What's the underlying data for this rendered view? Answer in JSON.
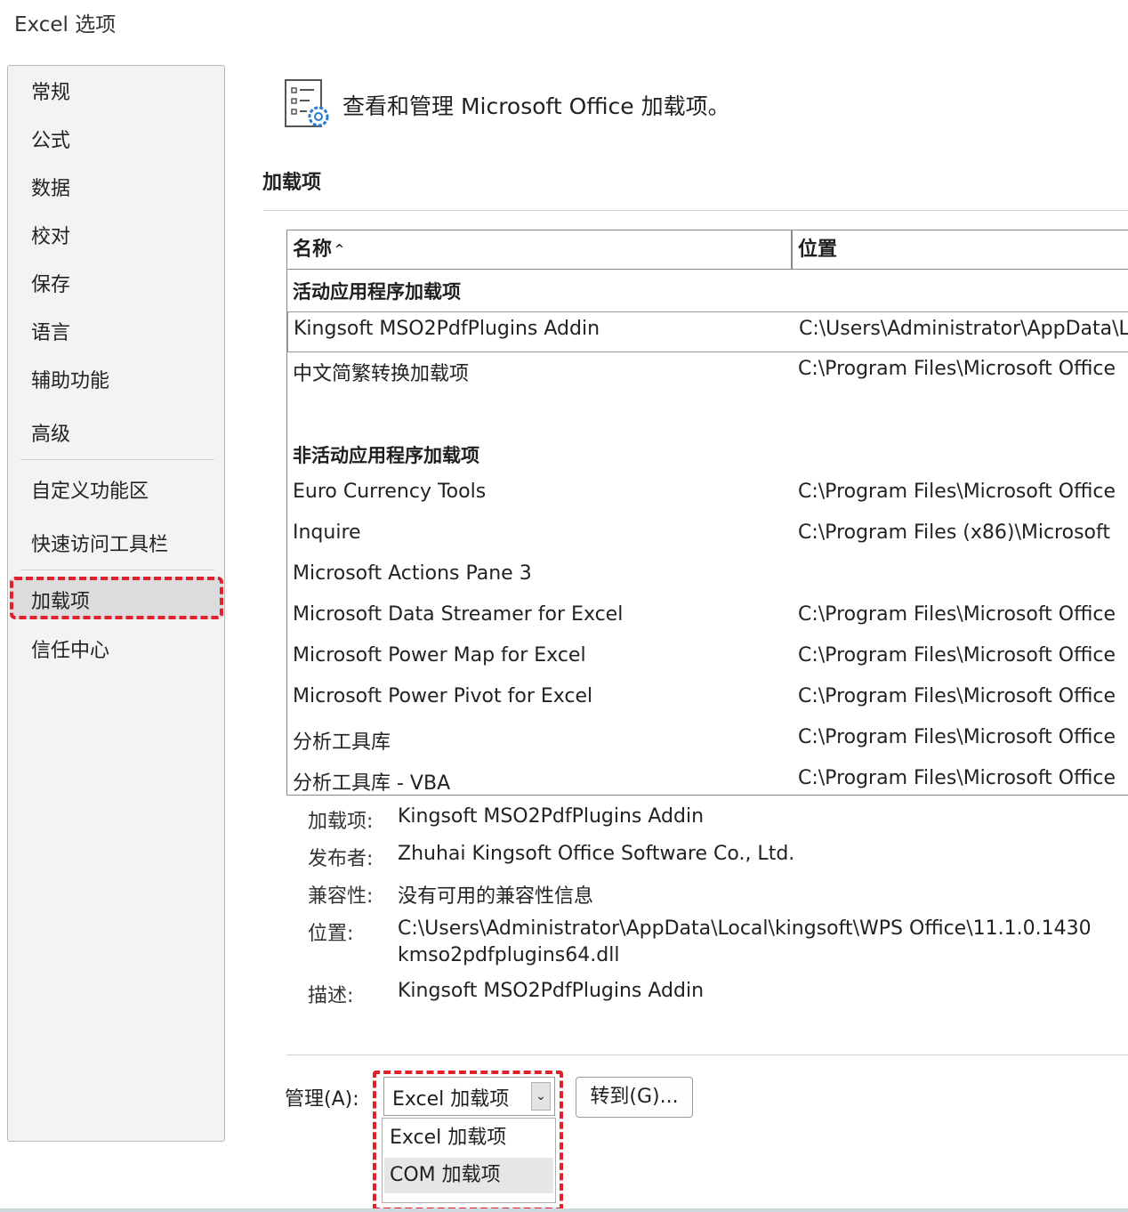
{
  "window": {
    "title": "Excel 选项"
  },
  "sidebar": {
    "items": [
      "常规",
      "公式",
      "数据",
      "校对",
      "保存",
      "语言",
      "辅助功能",
      "高级",
      "自定义功能区",
      "快速访问工具栏",
      "加载项",
      "信任中心"
    ],
    "selected": "加载项"
  },
  "header": {
    "icon": "addins-gear-icon",
    "text": "查看和管理 Microsoft Office 加载项。"
  },
  "section": {
    "label": "加载项"
  },
  "table": {
    "columns": {
      "name": "名称",
      "location": "位置"
    },
    "sort_icon": "sort-ascending-icon",
    "groups": {
      "active": {
        "title": "活动应用程序加载项",
        "rows": [
          {
            "name": "Kingsoft MSO2PdfPlugins Addin",
            "location": "C:\\Users\\Administrator\\AppData\\Local\\kingsoft\\"
          },
          {
            "name": "中文简繁转换加载项",
            "location": "C:\\Program Files\\Microsoft Office"
          }
        ]
      },
      "inactive": {
        "title": "非活动应用程序加载项",
        "rows": [
          {
            "name": "Euro Currency Tools",
            "location": "C:\\Program Files\\Microsoft Office"
          },
          {
            "name": "Inquire",
            "location": "C:\\Program Files (x86)\\Microsoft"
          },
          {
            "name": "Microsoft Actions Pane 3",
            "location": ""
          },
          {
            "name": "Microsoft Data Streamer for Excel",
            "location": "C:\\Program Files\\Microsoft Office"
          },
          {
            "name": "Microsoft Power Map for Excel",
            "location": "C:\\Program Files\\Microsoft Office"
          },
          {
            "name": "Microsoft Power Pivot for Excel",
            "location": "C:\\Program Files\\Microsoft Office"
          },
          {
            "name": "分析工具库",
            "location": "C:\\Program Files\\Microsoft Office"
          },
          {
            "name": "分析工具库 - VBA",
            "location": "C:\\Program Files\\Microsoft Office"
          }
        ]
      }
    }
  },
  "details": {
    "addin_label": "加载项:",
    "addin_value": "Kingsoft MSO2PdfPlugins Addin",
    "publisher_label": "发布者:",
    "publisher_value": "Zhuhai Kingsoft Office Software Co., Ltd.",
    "compat_label": "兼容性:",
    "compat_value": "没有可用的兼容性信息",
    "location_label": "位置:",
    "location_value_line1": "C:\\Users\\Administrator\\AppData\\Local\\kingsoft\\WPS Office\\11.1.0.1430",
    "location_value_line2": "kmso2pdfplugins64.dll",
    "desc_label": "描述:",
    "desc_value": "Kingsoft MSO2PdfPlugins Addin"
  },
  "manage": {
    "label": "管理(A):",
    "selected": "Excel 加载项",
    "options": [
      "Excel 加载项",
      "COM 加载项"
    ],
    "goto_label": "转到(G)..."
  },
  "colors": {
    "highlight": "#e0202a",
    "selected_bg": "#dcdcdc"
  }
}
